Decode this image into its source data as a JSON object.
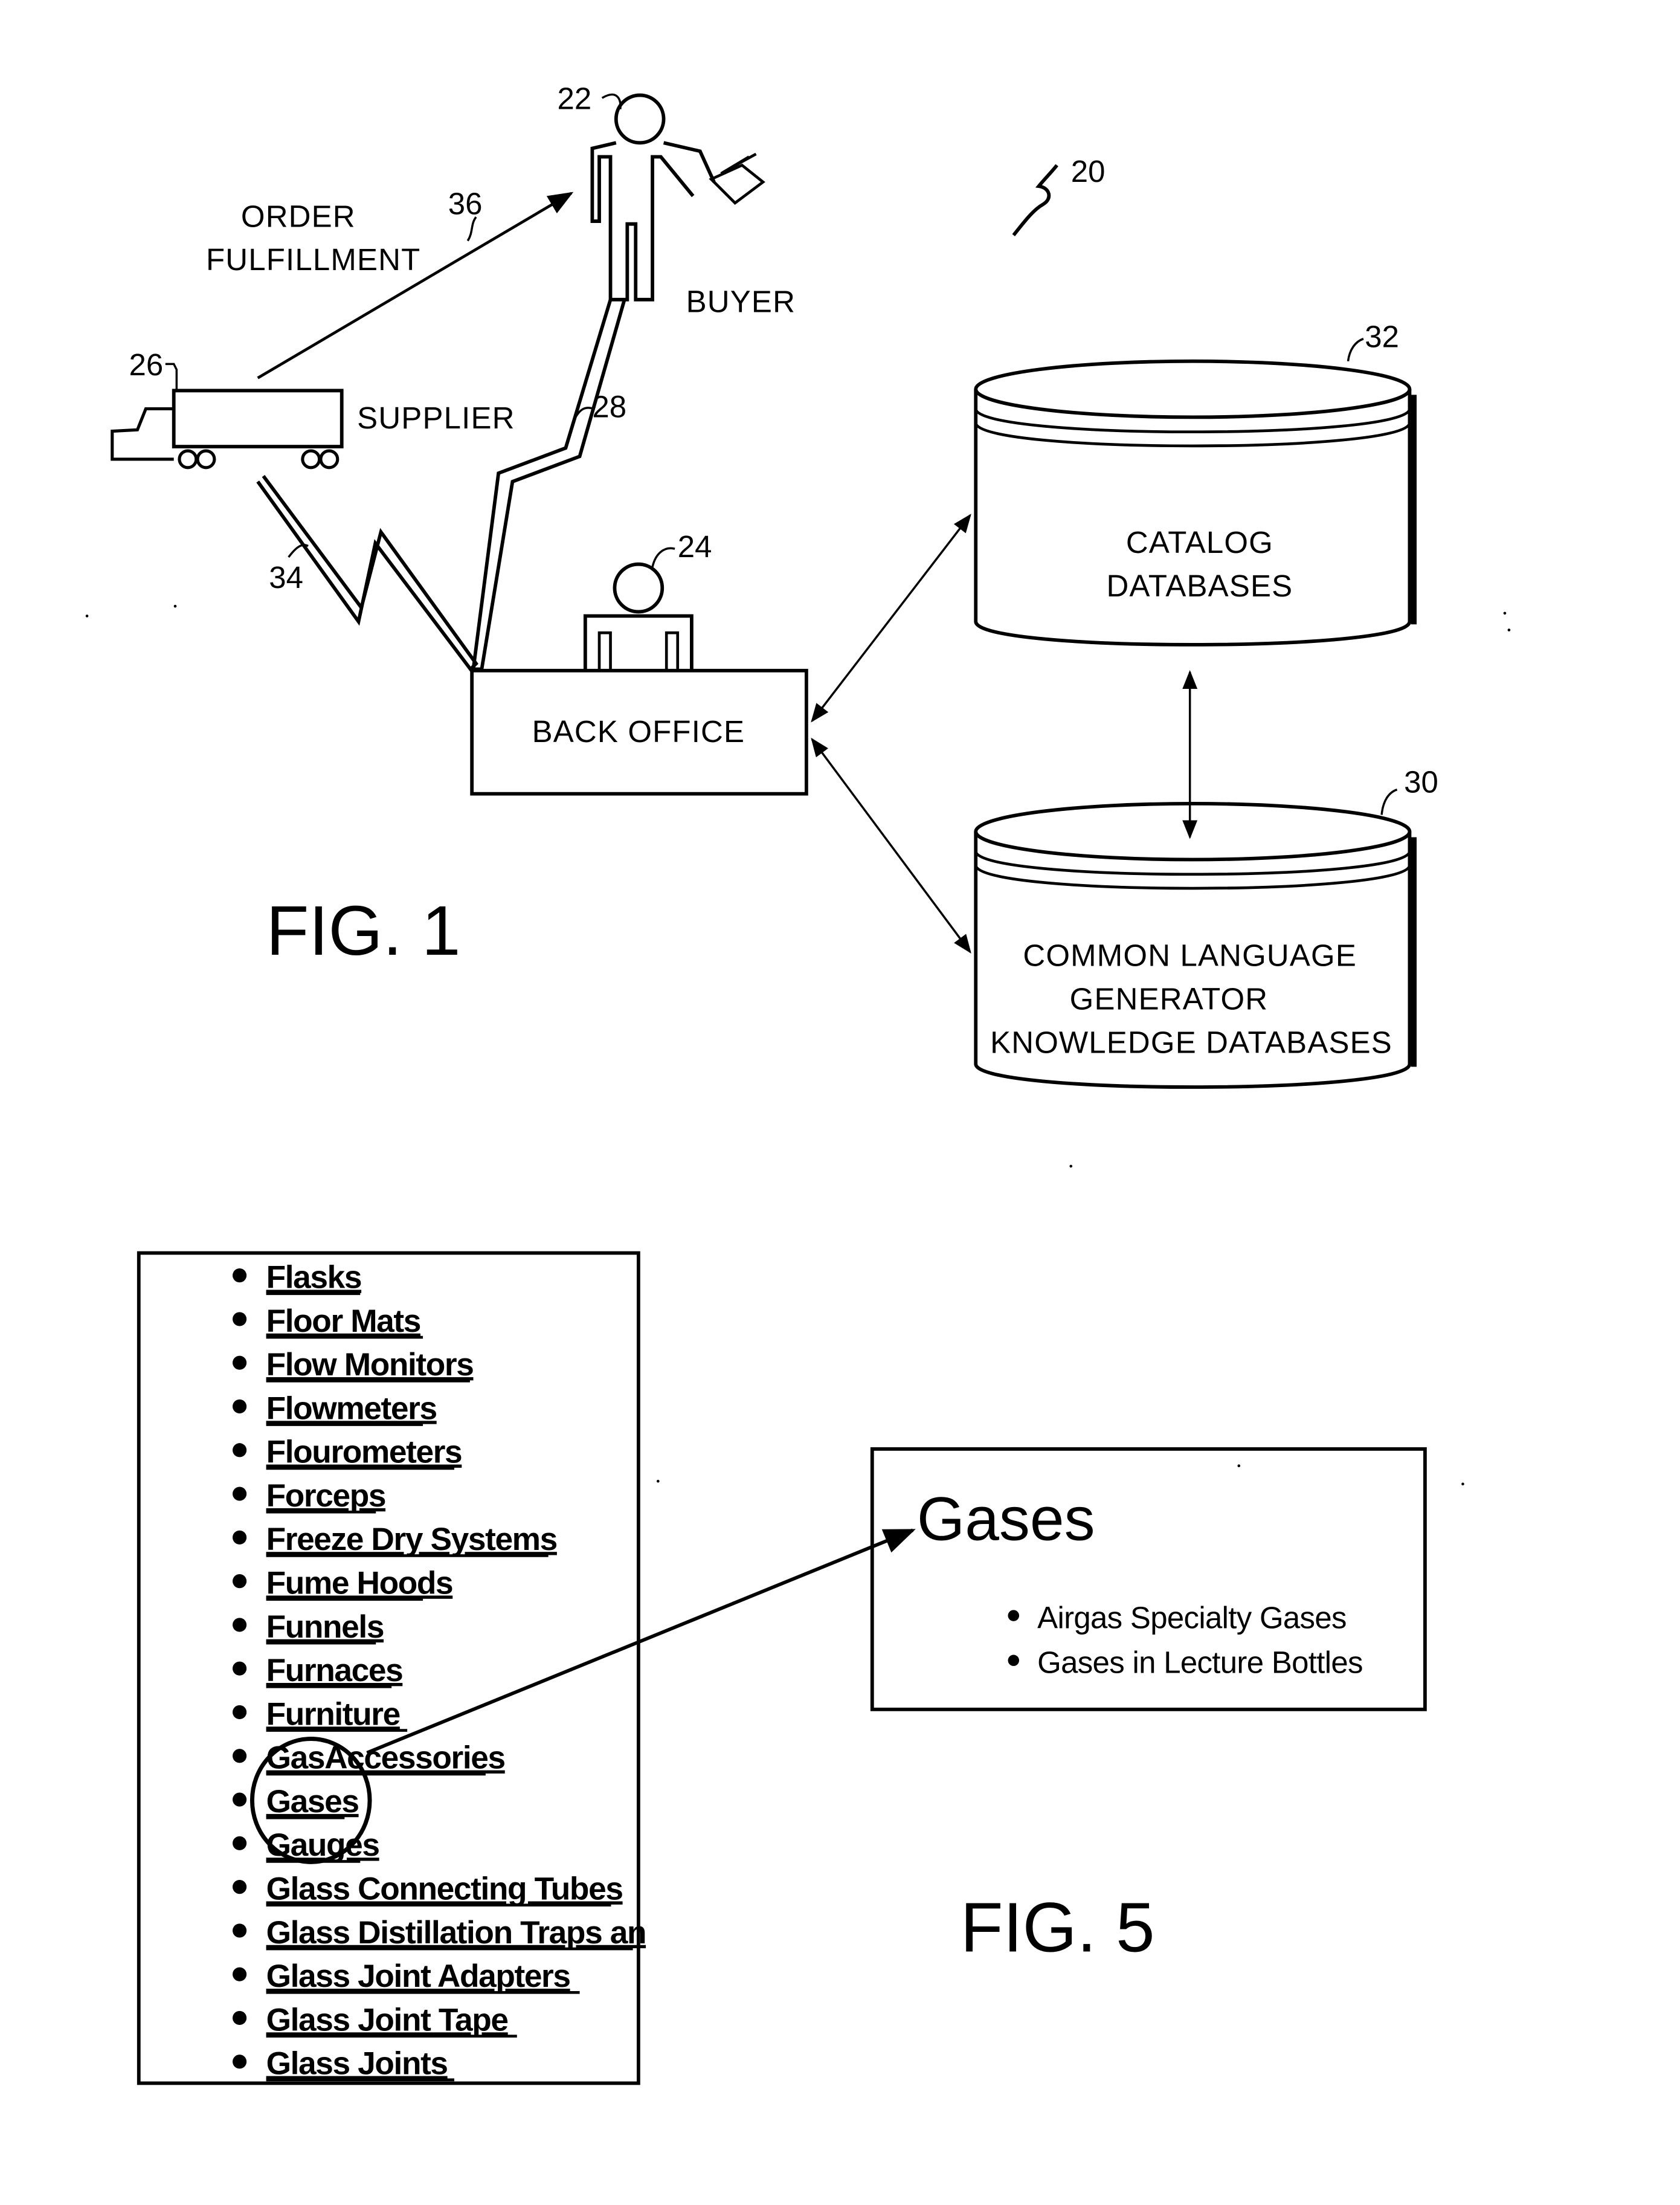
{
  "figure1": {
    "caption": "FIG. 1",
    "system_ref": "20",
    "buyer": {
      "ref": "22",
      "label": "BUYER"
    },
    "back_office": {
      "ref": "24",
      "label": "BACK OFFICE"
    },
    "supplier": {
      "ref": "26",
      "label": "SUPPLIER"
    },
    "link_buyer_backoffice": {
      "ref": "28"
    },
    "link_supplier_backoffice": {
      "ref": "34"
    },
    "order_fulfillment": {
      "ref": "36",
      "label_line1": "ORDER",
      "label_line2": "FULFILLMENT"
    },
    "catalog_db": {
      "ref": "32",
      "label_line1": "CATALOG",
      "label_line2": "DATABASES"
    },
    "knowledge_db": {
      "ref": "30",
      "label_line1": "COMMON LANGUAGE",
      "label_line2": "GENERATOR",
      "label_line3": "KNOWLEDGE DATABASES"
    }
  },
  "figure5": {
    "caption": "FIG. 5",
    "list_items": [
      "Flasks",
      "Floor Mats",
      "Flow Monitors",
      "Flowmeters",
      "Flourometers",
      "Forceps",
      "Freeze Dry Systems",
      "Fume Hoods",
      "Funnels",
      "Furnaces",
      "Furniture",
      "GasAccessories",
      "Gases",
      "Gauges",
      "Glass Connecting Tubes",
      "Glass Distillation Traps an",
      "Glass Joint Adapters",
      "Glass Joint Tape",
      "Glass Joints"
    ],
    "highlighted_item": "Gases",
    "detail_panel": {
      "title": "Gases",
      "items": [
        "Airgas Specialty Gases",
        "Gases in Lecture Bottles"
      ]
    }
  }
}
